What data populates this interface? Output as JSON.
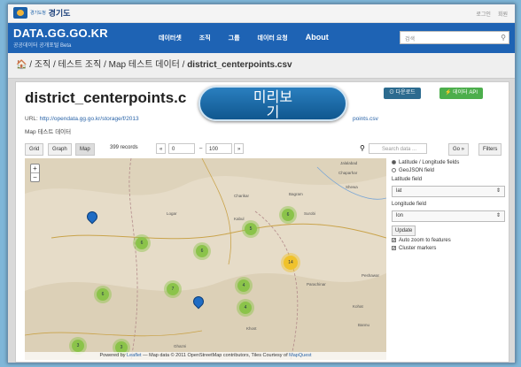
{
  "topbar": {
    "logo_small": "경기도청",
    "logo_text": "경기도",
    "links": [
      "로그인",
      "회원"
    ]
  },
  "navbar": {
    "brand_title": "DATA.GG.GO.KR",
    "brand_sub": "공공데이터 공개포털 Beta",
    "items": [
      "데이터셋",
      "조직",
      "그룹",
      "데이터 요청",
      "About"
    ],
    "search_placeholder": "검색"
  },
  "breadcrumb": {
    "home": "🏠",
    "trail": " / 조직 / 테스트 조직 / Map 테스트 데이터 / ",
    "current": "district_centerpoints.csv"
  },
  "resource": {
    "title": "district_centerpoints.c",
    "preview_overlay": "미리보\n기",
    "download_label": "⊙ 다운로드",
    "api_label": "⚡ 데이터 API",
    "url_prefix": "URL: ",
    "url": "http://opendata.gg.go.kr/storage/f/2013",
    "url_tail": "points.csv",
    "subheading": "Map 테스트 데이터"
  },
  "toolbar": {
    "views": [
      "Grid",
      "Graph",
      "Map"
    ],
    "records": "399 records",
    "prev": "«",
    "from": "0",
    "dash": "–",
    "to": "100",
    "next": "»",
    "search_placeholder": "Search data ...",
    "go_label": "Go »",
    "filters_label": "Filters"
  },
  "map": {
    "zoom_in": "+",
    "zoom_out": "−",
    "attribution_prefix": "Powered by ",
    "attribution_leaflet": "Leaflet",
    "attribution_mid": " — Map data © 2011 OpenStreetMap contributors, Tiles Courtesy of ",
    "attribution_mq": "MapQuest",
    "clusters": [
      "6",
      "5",
      "6",
      "6",
      "6",
      "7",
      "4",
      "4",
      "3",
      "3",
      "2"
    ],
    "big_cluster": "14",
    "labels": [
      "Jalalabad",
      "Charikar",
      "Bagram",
      "Chaparhar",
      "Shewa",
      "Surobi",
      "Kabul",
      "Khost",
      "Parachinar",
      "Kohat",
      "Bannu",
      "Peshawar",
      "Logar",
      "Ghazni"
    ]
  },
  "side": {
    "radio_latlon": "Latitude / Longitude fields",
    "radio_geojson": "GeoJSON field",
    "lat_label": "Latitude field",
    "lat_value": "lat",
    "lon_label": "Longitude field",
    "lon_value": "lon",
    "update_label": "Update",
    "auto_zoom": "Auto zoom to features",
    "cluster_markers": "Cluster markers"
  }
}
